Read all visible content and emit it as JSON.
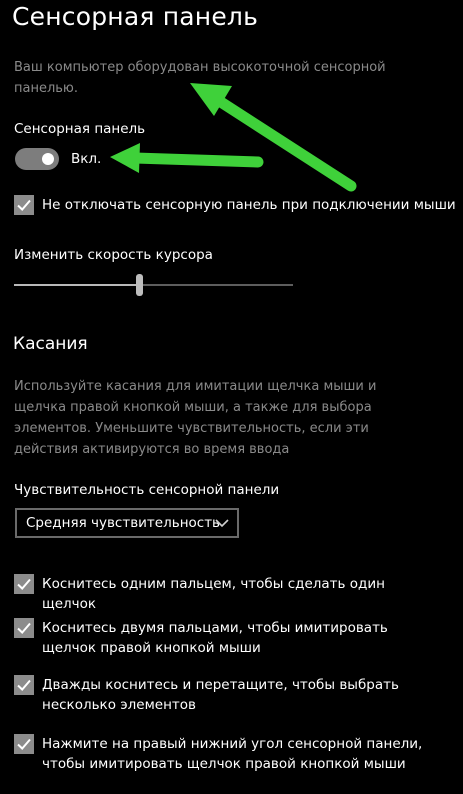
{
  "header": {
    "title": "Сенсорная панель",
    "description": "Ваш компьютер оборудован высокоточной сенсорной панелью."
  },
  "touchpad": {
    "label": "Сенсорная панель",
    "toggle_state": "Вкл.",
    "toggle_on": true,
    "leave_on_with_mouse": "Не отключать сенсорную панель при подключении мыши"
  },
  "cursor_speed": {
    "label": "Изменить скорость курсора",
    "value_fraction": 0.45
  },
  "taps": {
    "title": "Касания",
    "description": "Используйте касания для имитации щелчка мыши и щелчка правой кнопкой мыши, а также для выбора элементов. Уменьшите чувствительность, если эти действия активируются во время ввода",
    "sensitivity_label": "Чувствительность сенсорной панели",
    "sensitivity_value": "Средняя чувствительность",
    "options": [
      {
        "label": "Коснитесь одним пальцем, чтобы сделать один щелчок",
        "checked": true
      },
      {
        "label": "Коснитесь двумя пальцами, чтобы имитировать щелчок правой кнопкой мыши",
        "checked": true
      },
      {
        "label": "Дважды коснитесь и перетащите, чтобы выбрать несколько элементов",
        "checked": true
      },
      {
        "label": "Нажмите на правый нижний угол сенсорной панели, чтобы имитировать щелчок правой кнопкой мыши",
        "checked": true
      }
    ]
  },
  "colors": {
    "background": "#000000",
    "annotation_arrow": "#3fd13a"
  },
  "icons": {
    "checkbox": "checkmark-icon",
    "dropdown": "chevron-down-icon",
    "annotation": "arrow-icon"
  }
}
